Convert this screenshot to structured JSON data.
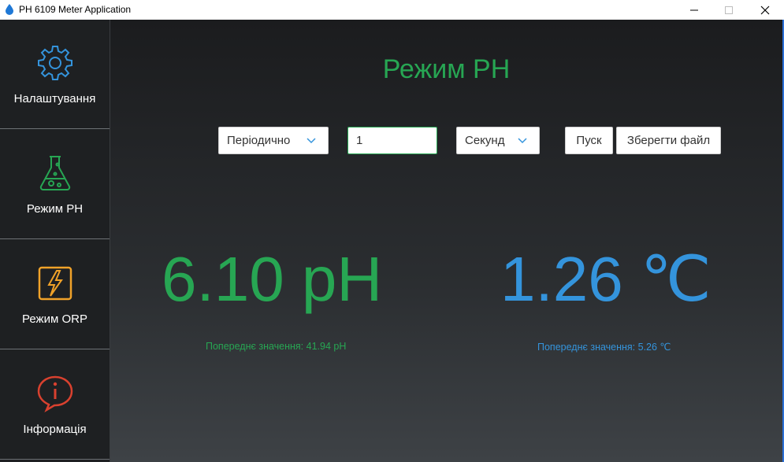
{
  "window": {
    "title": "PH 6109 Meter Application",
    "minimize_glyph": "—",
    "maximize_glyph": "☐",
    "close_glyph": "✕"
  },
  "sidebar": {
    "items": [
      {
        "label": "Налаштування",
        "icon": "gear-icon",
        "color": "#3494dc"
      },
      {
        "label": "Режим PH",
        "icon": "flask-icon",
        "color": "#27a653"
      },
      {
        "label": "Режим ORP",
        "icon": "lightning-icon",
        "color": "#f0a229"
      },
      {
        "label": "Інформація",
        "icon": "info-icon",
        "color": "#d9412f"
      }
    ]
  },
  "main": {
    "title": "Режим PH",
    "mode_select": {
      "value": "Періодично"
    },
    "interval_input": {
      "value": "1"
    },
    "unit_select": {
      "value": "Секунд"
    },
    "start_button": "Пуск",
    "save_button": "Зберегти файл",
    "ph_reading": "6.10 pH",
    "ph_previous": "Попереднє значення: 41.94 pH",
    "temp_reading": "1.26 ℃",
    "temp_previous": "Попереднє значення: 5.26 ℃"
  },
  "colors": {
    "accent_green": "#27a653",
    "accent_blue": "#3494dc",
    "accent_orange": "#f0a229",
    "accent_red": "#d9412f",
    "sidebar_bg": "#1e2022"
  }
}
